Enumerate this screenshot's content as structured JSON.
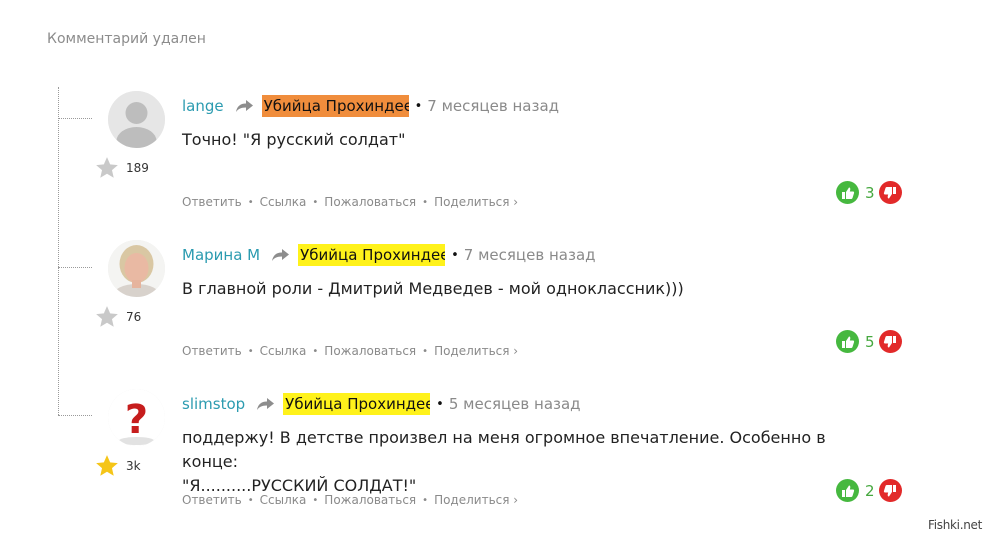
{
  "deleted_notice": "Комментарий удален",
  "actions": {
    "reply": "Ответить",
    "link": "Ссылка",
    "complain": "Пожаловаться",
    "share": "Поделиться ›"
  },
  "comments": [
    {
      "author": "lange",
      "reply_to": "Убийца Прохиндеев",
      "reply_to_color": "#f08d3c",
      "time": "7 месяцев назад",
      "text": "Точно! \"Я русский солдат\"",
      "rating": "189",
      "votes": "3",
      "avatar": "default-avatar"
    },
    {
      "author": "Марина М",
      "reply_to": "Убийца Прохиндеев",
      "reply_to_color": "#fff21b",
      "time": "7 месяцев назад",
      "text": "В главной роли - Дмитрий Медведев - мой одноклассник)))",
      "rating": "76",
      "votes": "5",
      "avatar": "photo-avatar"
    },
    {
      "author": "slimstop",
      "reply_to": "Убийца Прохиндеев",
      "reply_to_color": "#fff21b",
      "time": "5 месяцев назад",
      "text_line1": "поддержу! В детстве произвел на меня огромное впечатление. Особенно в конце:",
      "text_line2": "\"Я..........РУССКИЙ СОЛДАТ!\"",
      "rating": "3k",
      "votes": "2",
      "avatar": "question-mark-avatar"
    }
  ],
  "watermark": "Fishki.net",
  "colors": {
    "author": "#2b9bb0",
    "vote_up": "#46b83f",
    "vote_down": "#e22a2a",
    "star_gold": "#f5c518",
    "star_gray": "#c9c9c9"
  }
}
